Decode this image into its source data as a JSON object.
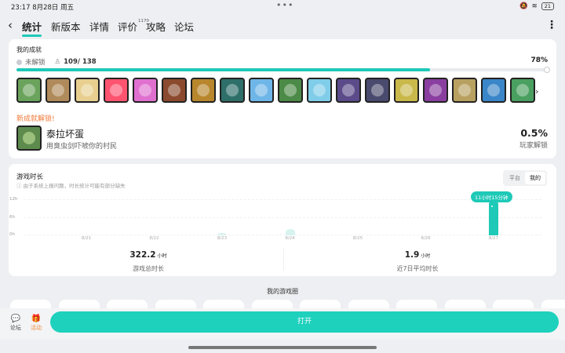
{
  "status": {
    "time": "23:17",
    "date": "8月28日 周五",
    "battery": "21"
  },
  "tabs": [
    {
      "label": "统计",
      "active": true,
      "sup": ""
    },
    {
      "label": "新版本",
      "active": false,
      "sup": ""
    },
    {
      "label": "详情",
      "active": false,
      "sup": ""
    },
    {
      "label": "评价",
      "active": false,
      "sup": "1170"
    },
    {
      "label": "攻略",
      "active": false,
      "sup": ""
    },
    {
      "label": "论坛",
      "active": false,
      "sup": ""
    }
  ],
  "achievements": {
    "title": "我的成就",
    "locked_label": "未解锁",
    "count": "109/ 138",
    "percent_text": "78%",
    "progress": 0.78,
    "icon_colors": [
      "#6aa35c",
      "#b08a5a",
      "#e8cf8f",
      "#ff5470",
      "#e070d0",
      "#8b4a2e",
      "#b8862d",
      "#2f6f6a",
      "#6fb6e8",
      "#4c8a47",
      "#7fcde8",
      "#5b4b8a",
      "#4a4a6e",
      "#c9b84a",
      "#8a3fa0",
      "#b8a060",
      "#3a86c8",
      "#4aa060"
    ],
    "new_label": "新成就解锁!",
    "new_name": "泰拉坏蛋",
    "new_desc": "用臭虫剑吓唬你的村民",
    "ratio": "0.5%",
    "ratio_label": "玩家解锁"
  },
  "playtime": {
    "title": "游戏时长",
    "note": "ⓘ 由于系统上报问题，时长统计可能有部分缺失",
    "segment": [
      "平台",
      "我的"
    ],
    "y_labels": [
      "12h",
      "6h",
      "0h"
    ],
    "tooltip": "11小时15分钟",
    "total_value": "322.2",
    "total_unit": "小时",
    "total_label": "游戏总时长",
    "avg_value": "1.9",
    "avg_unit": "小时",
    "avg_label": "近7日平均时长"
  },
  "chart_data": {
    "type": "bar",
    "categories": [
      "8/21",
      "8/22",
      "8/23",
      "8/24",
      "8/25",
      "8/26",
      "8/27"
    ],
    "values": [
      0,
      0,
      0.3,
      0.9,
      0,
      0,
      11.25
    ],
    "ylim": [
      0,
      12
    ],
    "y_ticks": [
      "12h",
      "6h",
      "0h"
    ]
  },
  "circle": {
    "title": "我的游戏圈"
  },
  "bottom": {
    "forum": "论坛",
    "activity": "活动",
    "open": "打开"
  }
}
